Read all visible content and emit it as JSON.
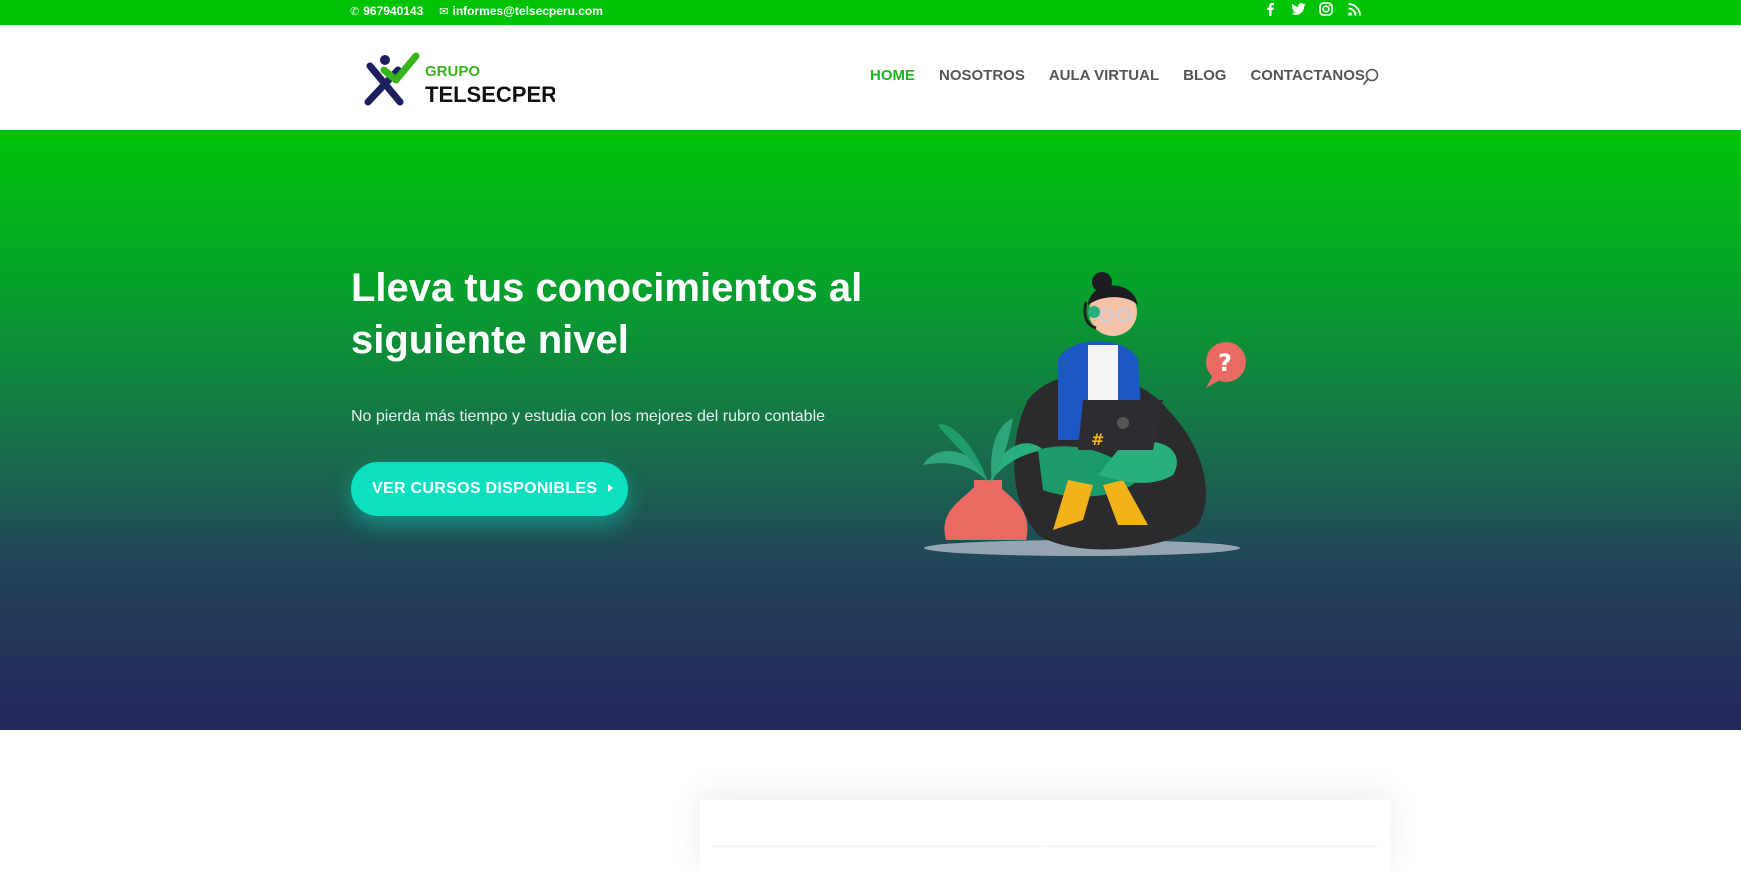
{
  "topbar": {
    "phone": "967940143",
    "email": "informes@telsecperu.com",
    "social_icons": [
      "facebook-icon",
      "twitter-icon",
      "instagram-icon",
      "rss-icon"
    ],
    "color": "#00c307"
  },
  "header": {
    "logo_line1": "GRUPO",
    "logo_line2": "TELSECPERU",
    "nav": [
      {
        "label": "HOME",
        "active": true
      },
      {
        "label": "NOSOTROS",
        "active": false
      },
      {
        "label": "AULA VIRTUAL",
        "active": false
      },
      {
        "label": "BLOG",
        "active": false
      },
      {
        "label": "CONTACTANOS",
        "active": false
      }
    ],
    "active_color": "#1cb51f"
  },
  "hero": {
    "title": "Lleva tus conocimientos al siguiente nivel",
    "subtitle": "No pierda más tiempo y estudia con los mejores del rubro contable",
    "button_label": "VER CURSOS DISPONIBLES",
    "button_color": "#0ce0c0",
    "gradient": [
      "#00c307",
      "#24275c"
    ]
  }
}
